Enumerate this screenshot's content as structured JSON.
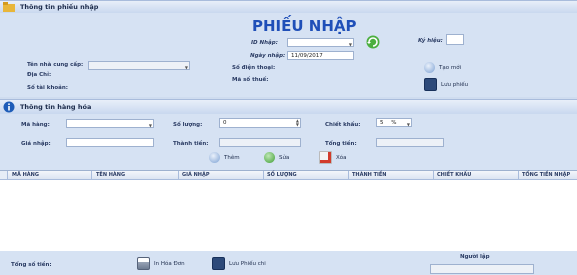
{
  "sections": {
    "phieu_nhap": "Thông tin phiếu nhập",
    "hang_hoa": "Thông tin hàng hóa"
  },
  "header": {
    "title": "PHIẾU NHẬP",
    "id_label": "ID Nhập:",
    "ngay_label": "Ngày nhập:",
    "ngay_value": "11/09/2017",
    "kyhieu_label": "Ký hiệu:"
  },
  "supplier": {
    "ten_label": "Tên nhà cung cấp:",
    "diachi_label": "Địa Chỉ:",
    "sotk_label": "Số tài khoản:",
    "sdt_label": "Số điện thoại:",
    "mst_label": "Mã số thuế:"
  },
  "actions": {
    "tao_moi": "Tạo mới",
    "luu_phieu": "Lưu phiếu"
  },
  "goods": {
    "mahang_label": "Mã hàng:",
    "soluong_label": "Số lượng:",
    "soluong_value": "0",
    "chietkhau_label": "Chiết khấu:",
    "chietkhau_value": "5",
    "chietkhau_unit": "%",
    "gianhap_label": "Giá nhập:",
    "thanhtien_label": "Thành tiền:",
    "tongtien_label": "Tổng tiền:",
    "them": "Thêm",
    "sua": "Sửa",
    "xoa": "Xóa"
  },
  "grid": {
    "columns": [
      "MÃ HÀNG",
      "TÊN HÀNG",
      "GIÁ NHẬP",
      "SỐ LƯỢNG",
      "THÀNH TIỀN",
      "CHIẾT KHẤU",
      "TỔNG TIỀN NHẬP"
    ]
  },
  "footer": {
    "tong_so_label": "Tổng số tiền:",
    "in_hoa_don": "In Hóa Đơn",
    "luu_phieu_chi": "Lưu Phiếu chi",
    "nguoi_lap": "Người lập"
  }
}
